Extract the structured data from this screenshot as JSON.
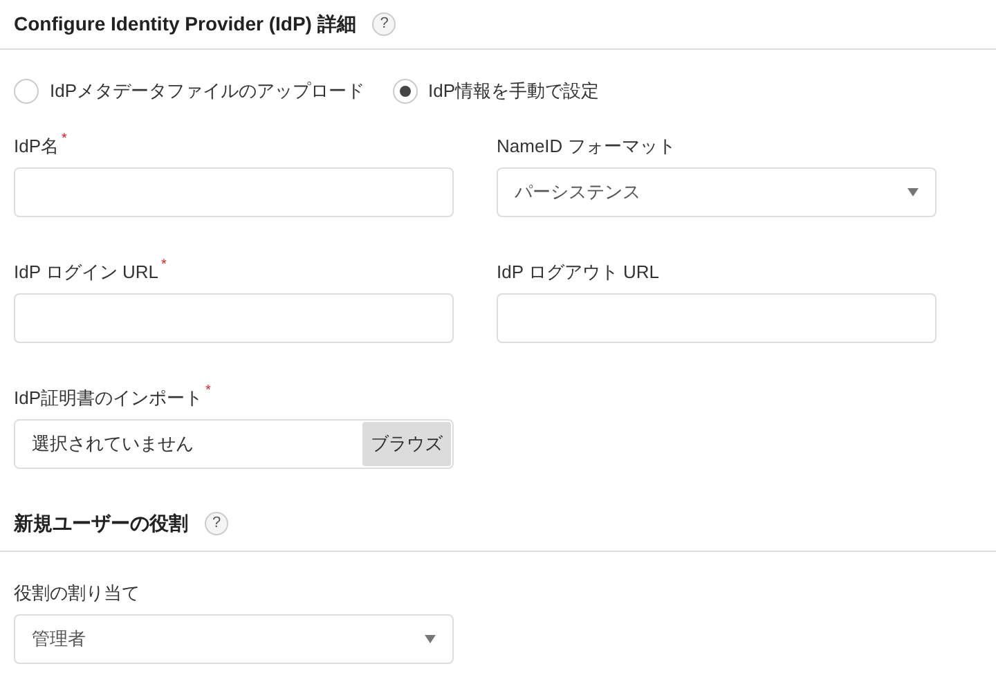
{
  "sections": [
    {
      "title": "Configure Identity Provider (IdP) 詳細",
      "help": "?",
      "options": [
        {
          "label": "IdPメタデータファイルのアップロード",
          "selected": false
        },
        {
          "label": "IdP情報を手動で設定",
          "selected": true
        }
      ],
      "fields": [
        {
          "kind": "text",
          "label": "IdP名",
          "required_mark": "*"
        },
        {
          "kind": "select",
          "label": "NameID フォーマット",
          "value": "パーシステンス"
        },
        {
          "kind": "text",
          "label": "IdP ログイン URL",
          "required_mark": "*"
        },
        {
          "kind": "text",
          "label": "IdP ログアウト URL"
        },
        {
          "kind": "file",
          "label": "IdP証明書のインポート",
          "required_mark": "*",
          "value": "選択されていません",
          "button": "ブラウズ"
        }
      ]
    },
    {
      "title": "新規ユーザーの役割",
      "help": "?",
      "fields": [
        {
          "kind": "select",
          "label": "役割の割り当て",
          "value": "管理者"
        }
      ]
    }
  ]
}
